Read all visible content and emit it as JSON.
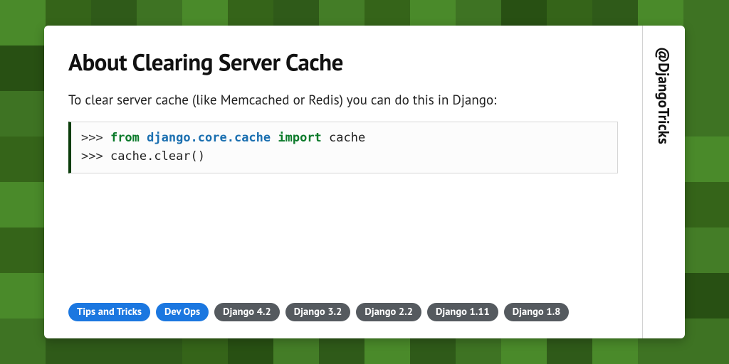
{
  "title": "About Clearing Server Cache",
  "description": "To clear server cache (like Memcached or Redis) you can do this in Django:",
  "code": {
    "lines": [
      {
        "prompt": ">>> ",
        "tokens": [
          {
            "t": "from ",
            "c": "kw"
          },
          {
            "t": "django.core.cache ",
            "c": "mod"
          },
          {
            "t": "import ",
            "c": "kw"
          },
          {
            "t": "cache",
            "c": "id"
          }
        ]
      },
      {
        "prompt": ">>> ",
        "tokens": [
          {
            "t": "cache.clear()",
            "c": "id"
          }
        ]
      }
    ]
  },
  "tags": [
    {
      "label": "Tips and Tricks",
      "style": "blue"
    },
    {
      "label": "Dev Ops",
      "style": "blue"
    },
    {
      "label": "Django 4.2",
      "style": "gray"
    },
    {
      "label": "Django 3.2",
      "style": "gray"
    },
    {
      "label": "Django 2.2",
      "style": "gray"
    },
    {
      "label": "Django 1.11",
      "style": "gray"
    },
    {
      "label": "Django 1.8",
      "style": "gray"
    }
  ],
  "handle": "@DjangoTricks",
  "bg": {
    "palette": [
      "#2f5a19",
      "#3e7323",
      "#4a8a2a",
      "#356419",
      "#285013",
      "#447d27"
    ],
    "cols": 16,
    "rows": 8,
    "seed": 7
  }
}
